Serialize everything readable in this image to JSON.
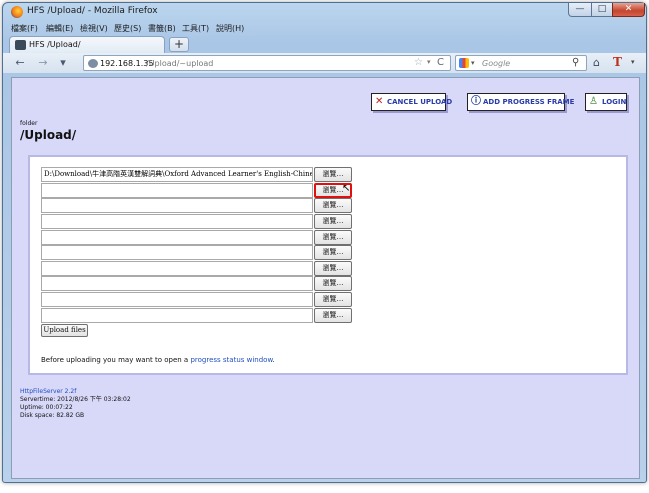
{
  "window": {
    "title": "HFS /Upload/ - Mozilla Firefox",
    "min_symbol": "—",
    "max_symbol": "□",
    "close_symbol": "✕"
  },
  "menubar": [
    "檔案(F)",
    "編輯(E)",
    "檢視(V)",
    "歷史(S)",
    "書籤(B)",
    "工具(T)",
    "說明(H)"
  ],
  "tab": {
    "label": "HFS /Upload/",
    "new_tab_symbol": "+"
  },
  "navbar": {
    "back_symbol": "←",
    "forward_symbol": "→",
    "url_host": "192.168.1.35",
    "url_path": "/Upload/~upload",
    "star_symbol": "☆",
    "reload_symbol": "C",
    "search_placeholder": "Google",
    "search_symbol": "⚲",
    "home_symbol": "⌂",
    "addon_letter": "T",
    "dropdown_symbol": "▾"
  },
  "toolbar": {
    "cancel_upload": "CANCEL UPLOAD",
    "add_progress_frame": "ADD PROGRESS FRAME",
    "login": "LOGIN"
  },
  "folder": {
    "label": "folder",
    "path": "/Upload/"
  },
  "upload": {
    "rows": [
      {
        "value": "D:\\Download\\牛津高階英漢雙解詞典\\Oxford Advanced Learner's English-Chinese(T) Dictionary",
        "browse": "瀏覽…"
      },
      {
        "value": "",
        "browse": "瀏覽…"
      },
      {
        "value": "",
        "browse": "瀏覽…"
      },
      {
        "value": "",
        "browse": "瀏覽…"
      },
      {
        "value": "",
        "browse": "瀏覽…"
      },
      {
        "value": "",
        "browse": "瀏覽…"
      },
      {
        "value": "",
        "browse": "瀏覽…"
      },
      {
        "value": "",
        "browse": "瀏覽…"
      },
      {
        "value": "",
        "browse": "瀏覽…"
      },
      {
        "value": "",
        "browse": "瀏覽…"
      }
    ],
    "submit_label": "Upload files",
    "note_before": "Before uploading you may want to open a ",
    "note_link": "progress status window",
    "note_after": "."
  },
  "footer": {
    "server_name": "HttpFileServer 2.2f",
    "servertime": "Servertime: 2012/8/26 下午 03:28:02",
    "uptime": "Uptime: 00:07:22",
    "disk_space": "Disk space: 82.82 GB"
  },
  "colors": {
    "page_background": "#d8d8f8",
    "button_text": "#2a3ca8",
    "link": "#2050c0",
    "highlight": "#e01010"
  }
}
